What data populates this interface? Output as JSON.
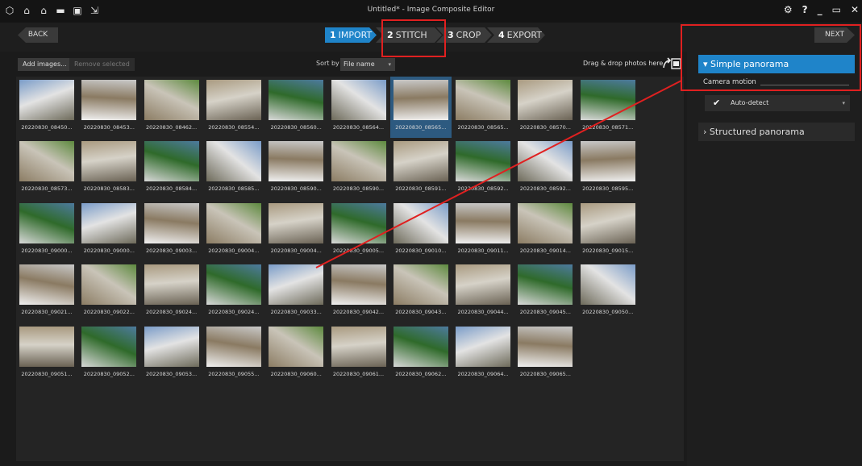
{
  "window": {
    "title": "Untitled* - Image Composite Editor",
    "toolbar_icons": [
      "cube-icon",
      "new-project-icon",
      "open-project-icon",
      "folder-icon",
      "save-icon",
      "export-icon"
    ],
    "controls": [
      "settings-icon",
      "help-icon",
      "minimize-icon",
      "restore-icon",
      "close-icon"
    ],
    "control_glyphs": [
      "⚙",
      "?",
      "_",
      "▭",
      "✕"
    ]
  },
  "nav": {
    "back": "BACK",
    "next": "NEXT",
    "steps": [
      {
        "num": "1",
        "label": "IMPORT",
        "active": true
      },
      {
        "num": "2",
        "label": "STITCH",
        "active": false
      },
      {
        "num": "3",
        "label": "CROP",
        "active": false
      },
      {
        "num": "4",
        "label": "EXPORT",
        "active": false
      }
    ]
  },
  "toolbar": {
    "add_images": "Add images...",
    "remove_selected": "Remove selected",
    "sort_label": "Sort by",
    "sort_value": "File name",
    "drag_drop": "Drag & drop photos here"
  },
  "thumbnails": [
    "20220830_08450...",
    "20220830_08453...",
    "20220830_08462...",
    "20220830_08554...",
    "20220830_08560...",
    "20220830_08564...",
    "20220830_08565...",
    "20220830_08565...",
    "20220830_08570...",
    "20220830_08571...",
    "20220830_08573...",
    "20220830_08583...",
    "20220830_08584...",
    "20220830_08585...",
    "20220830_08590...",
    "20220830_08590...",
    "20220830_08591...",
    "20220830_08592...",
    "20220830_08592...",
    "20220830_08595...",
    "20220830_09000...",
    "20220830_09000...",
    "20220830_09003...",
    "20220830_09004...",
    "20220830_09004...",
    "20220830_09005...",
    "20220830_09010...",
    "20220830_09011...",
    "20220830_09014...",
    "20220830_09015...",
    "20220830_09021...",
    "20220830_09022...",
    "20220830_09024...",
    "20220830_09024...",
    "20220830_09033...",
    "20220830_09042...",
    "20220830_09043...",
    "20220830_09044...",
    "20220830_09045...",
    "20220830_09050...",
    "20220830_09051...",
    "20220830_09052...",
    "20220830_09053...",
    "20220830_09055...",
    "20220830_09060...",
    "20220830_09061...",
    "20220830_09062...",
    "20220830_09064...",
    "20220830_09065..."
  ],
  "selected_index": 6,
  "panel": {
    "simple": "Simple panorama",
    "camera_motion": "Camera motion",
    "auto_detect": "Auto-detect",
    "structured": "Structured panorama"
  },
  "colors": {
    "accent": "#1f84c9",
    "annotation": "#e02020"
  }
}
